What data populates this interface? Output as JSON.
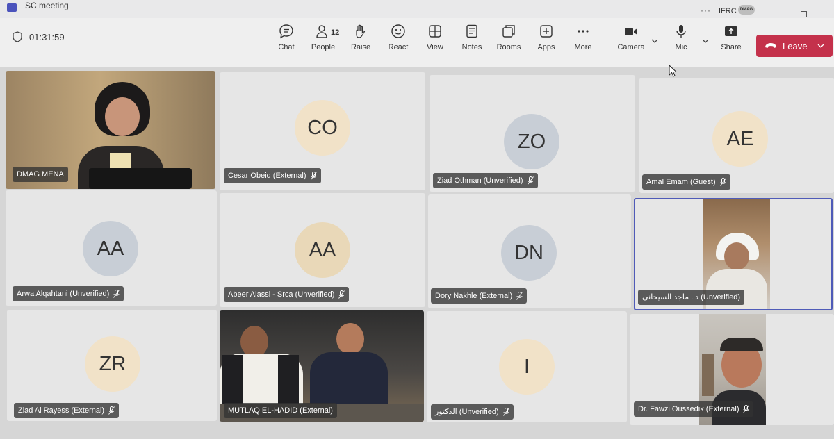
{
  "window": {
    "title": "SC meeting",
    "more_dots": "···",
    "org_name": "IFRC",
    "org_avatar_text": "DMAG"
  },
  "meeting": {
    "elapsed": "01:31:59"
  },
  "toolbar": {
    "chat": "Chat",
    "people": "People",
    "people_count": "12",
    "raise": "Raise",
    "react": "React",
    "view": "View",
    "notes": "Notes",
    "rooms": "Rooms",
    "apps": "Apps",
    "more": "More",
    "camera": "Camera",
    "mic": "Mic",
    "share": "Share",
    "leave": "Leave"
  },
  "participants": [
    {
      "name": "DMAG MENA",
      "initials": "",
      "video": true,
      "muted": false
    },
    {
      "name": "Cesar Obeid (External)",
      "initials": "CO",
      "video": false,
      "muted": true
    },
    {
      "name": "Ziad Othman (Unverified)",
      "initials": "ZO",
      "video": false,
      "muted": true
    },
    {
      "name": "Amal Emam (Guest)",
      "initials": "AE",
      "video": false,
      "muted": true
    },
    {
      "name": "Arwa Alqahtani (Unverified)",
      "initials": "AA",
      "video": false,
      "muted": true
    },
    {
      "name": "Abeer Alassi - Srca (Unverified)",
      "initials": "AA",
      "video": false,
      "muted": true
    },
    {
      "name": "Dory Nakhle (External)",
      "initials": "DN",
      "video": false,
      "muted": true
    },
    {
      "name": "د . ماجد السيحاني (Unverified)",
      "initials": "",
      "video": true,
      "muted": false,
      "active": true
    },
    {
      "name": "Ziad Al Rayess (External)",
      "initials": "ZR",
      "video": false,
      "muted": true
    },
    {
      "name": "MUTLAQ EL-HADID (External)",
      "initials": "",
      "video": true,
      "muted": false
    },
    {
      "name": "الدكتور (Unverified)",
      "initials": "I",
      "video": false,
      "muted": true
    },
    {
      "name": "Dr. Fawzi Oussedik (External)",
      "initials": "",
      "video": true,
      "muted": true
    }
  ],
  "colors": {
    "leave": "#c4314b",
    "active_border": "#4f5bb8",
    "avatar_warm": "#f1e2c8",
    "avatar_cool": "#c8ced6",
    "avatar_sand": "#e9d8b8"
  }
}
